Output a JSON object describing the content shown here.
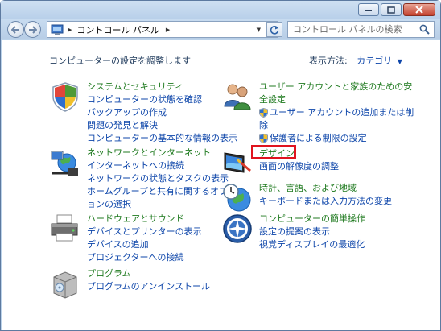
{
  "address": {
    "path": "コントロール パネル"
  },
  "search": {
    "placeholder": "コントロール パネルの検索"
  },
  "header": {
    "title": "コンピューターの設定を調整します",
    "view_by_label": "表示方法:",
    "view_by_value": "カテゴリ"
  },
  "categories": {
    "system": {
      "title": "システムとセキュリティ",
      "links": [
        "コンピューターの状態を確認",
        "バックアップの作成",
        "問題の発見と解決",
        "コンピューターの基本的な情報の表示"
      ]
    },
    "network": {
      "title": "ネットワークとインターネット",
      "links": [
        "インターネットへの接続",
        "ネットワークの状態とタスクの表示",
        "ホームグループと共有に関するオプシ",
        "ョンの選択"
      ]
    },
    "hardware": {
      "title": "ハードウェアとサウンド",
      "links": [
        "デバイスとプリンターの表示",
        "デバイスの追加",
        "プロジェクターへの接続"
      ]
    },
    "programs": {
      "title": "プログラム",
      "links": [
        "プログラムのアンインストール"
      ]
    },
    "users": {
      "title_line1": "ユーザー アカウントと家族のための安",
      "title_line2": "全設定",
      "links": [
        "ユーザー アカウントの追加または削",
        "除",
        "保護者による制限の設定"
      ]
    },
    "design": {
      "title": "デザイン",
      "links": [
        "画面の解像度の調整"
      ]
    },
    "clock": {
      "title": "時計、言語、および地域",
      "links": [
        "キーボードまたは入力方法の変更"
      ]
    },
    "ease": {
      "title": "コンピューターの簡単操作",
      "links": [
        "設定の提案の表示",
        "視覚ディスプレイの最適化"
      ]
    }
  },
  "colors": {
    "category_title": "#1f7a1f",
    "link": "#0e46aa",
    "highlight": "#e0141e"
  }
}
